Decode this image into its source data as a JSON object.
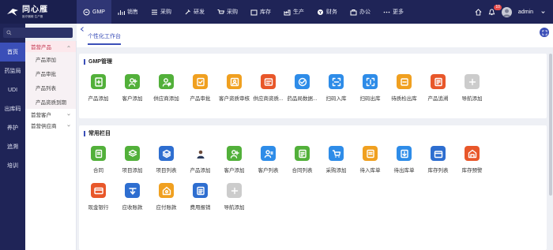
{
  "app": {
    "title": "同心雁",
    "subtitle": "医疗器械·生产服"
  },
  "topnav": [
    {
      "label": "GMP",
      "icon": "gmp-icon",
      "active": true
    },
    {
      "label": "销售",
      "icon": "chart-icon",
      "active": false
    },
    {
      "label": "采购",
      "icon": "list-icon",
      "active": false
    },
    {
      "label": "研发",
      "icon": "tools-icon",
      "active": false
    },
    {
      "label": "采购",
      "icon": "cart-icon",
      "active": false
    },
    {
      "label": "库存",
      "icon": "box-icon",
      "active": false
    },
    {
      "label": "生产",
      "icon": "factory-icon",
      "active": false
    },
    {
      "label": "财务",
      "icon": "coin-icon",
      "active": false
    },
    {
      "label": "办公",
      "icon": "briefcase-icon",
      "active": false
    },
    {
      "label": "更多",
      "icon": "more-icon",
      "active": false
    }
  ],
  "topright": {
    "notifications": "10",
    "username": "admin"
  },
  "sidebar": {
    "search_placeholder": "",
    "items": [
      {
        "label": "首页",
        "active": true
      },
      {
        "label": "药监局",
        "active": false
      },
      {
        "label": "UDI",
        "active": false
      },
      {
        "label": "出库码",
        "active": false
      },
      {
        "label": "养护",
        "active": false
      },
      {
        "label": "追溯",
        "active": false
      },
      {
        "label": "培训",
        "active": false
      }
    ]
  },
  "submenu": {
    "groups": [
      {
        "label": "首营产品",
        "open": true,
        "children": [
          "产品添加",
          "产品审批",
          "产品列表",
          "产品资质到期"
        ]
      },
      {
        "label": "首营客户",
        "open": false,
        "children": []
      },
      {
        "label": "首营供应商",
        "open": false,
        "children": []
      }
    ]
  },
  "tabs": [
    {
      "label": "个性化工作台",
      "active": true
    }
  ],
  "panels": [
    {
      "title": "GMP管理",
      "tiles": [
        {
          "label": "产品添加",
          "color": "#52b03a",
          "icon": "add-doc-icon"
        },
        {
          "label": "客户添加",
          "color": "#52b03a",
          "icon": "add-user-icon"
        },
        {
          "label": "供应商添加",
          "color": "#52b03a",
          "icon": "add-supplier-icon"
        },
        {
          "label": "产品审批",
          "color": "#f0a020",
          "icon": "approve-icon"
        },
        {
          "label": "客户资质审核",
          "color": "#f0a020",
          "icon": "user-audit-icon"
        },
        {
          "label": "供应商资质...",
          "color": "#e8572a",
          "icon": "supplier-audit-icon"
        },
        {
          "label": "药品局数据...",
          "color": "#2e8ce8",
          "icon": "database-icon"
        },
        {
          "label": "扫码入库",
          "color": "#2e8ce8",
          "icon": "scan-in-icon"
        },
        {
          "label": "扫码出库",
          "color": "#2e8ce8",
          "icon": "scan-out-icon"
        },
        {
          "label": "待质检出库",
          "color": "#f0a020",
          "icon": "inspect-icon"
        },
        {
          "label": "产品追溯",
          "color": "#e8572a",
          "icon": "trace-icon"
        },
        {
          "label": "导航添加",
          "color": "#cccccc",
          "icon": "plus-icon"
        }
      ]
    },
    {
      "title": "常用栏目",
      "tiles": [
        {
          "label": "合同",
          "color": "#52b03a",
          "icon": "contract-icon"
        },
        {
          "label": "项目添加",
          "color": "#52b03a",
          "icon": "project-add-icon"
        },
        {
          "label": "项目列表",
          "color": "#2e6ed0",
          "icon": "layers-icon"
        },
        {
          "label": "产品添加",
          "color": "#ffffff",
          "icon": "person-photo-icon"
        },
        {
          "label": "客户添加",
          "color": "#52b03a",
          "icon": "add-user-icon"
        },
        {
          "label": "客户列表",
          "color": "#2e8ce8",
          "icon": "user-list-icon"
        },
        {
          "label": "合同列表",
          "color": "#52b03a",
          "icon": "contract-list-icon"
        },
        {
          "label": "采购添加",
          "color": "#2e8ce8",
          "icon": "purchase-add-icon"
        },
        {
          "label": "待入库单",
          "color": "#f0a020",
          "icon": "inbound-icon"
        },
        {
          "label": "待出库单",
          "color": "#2e8ce8",
          "icon": "outbound-icon"
        },
        {
          "label": "库存列表",
          "color": "#2e6ed0",
          "icon": "inventory-icon"
        },
        {
          "label": "库存预警",
          "color": "#e8572a",
          "icon": "warehouse-icon"
        },
        {
          "label": "现金银行",
          "color": "#e8572a",
          "icon": "card-icon"
        },
        {
          "label": "应收账款",
          "color": "#2e6ed0",
          "icon": "receivable-icon"
        },
        {
          "label": "应付账款",
          "color": "#f0a020",
          "icon": "payable-icon"
        },
        {
          "label": "费用报销",
          "color": "#2e6ed0",
          "icon": "expense-icon"
        },
        {
          "label": "导航添加",
          "color": "#cccccc",
          "icon": "plus-icon"
        }
      ]
    }
  ]
}
